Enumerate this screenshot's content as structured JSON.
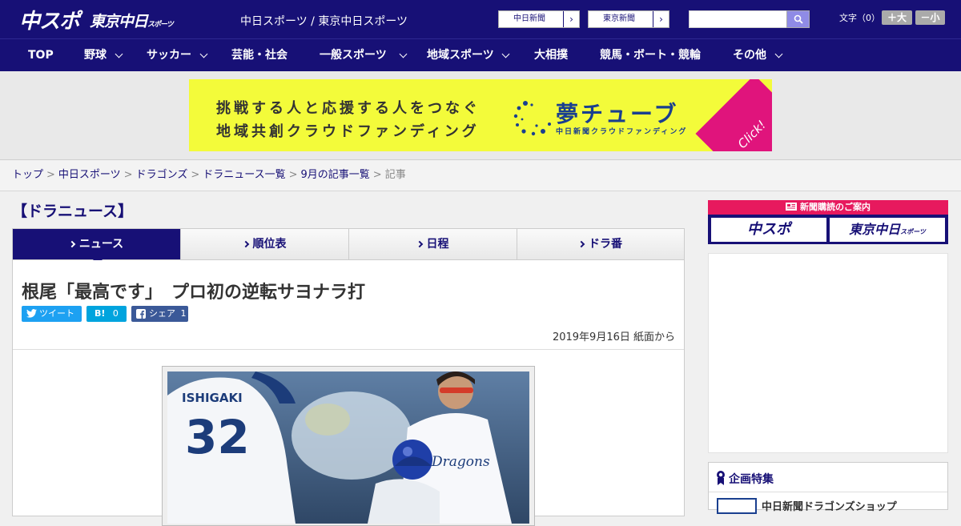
{
  "header": {
    "logo_main": "中スポ",
    "logo_tokyo": "東京中日",
    "logo_tokyo_small": "スポーツ",
    "site_names": "中日スポーツ / 東京中日スポーツ",
    "site_buttons": [
      "中日新聞",
      "東京新聞"
    ],
    "search_placeholder": "",
    "font_size_label": "文字（0）",
    "font_larger": "＋大",
    "font_smaller": "－小"
  },
  "nav": {
    "items": [
      {
        "label": "TOP",
        "dropdown": false
      },
      {
        "label": "野球",
        "dropdown": true
      },
      {
        "label": "サッカー",
        "dropdown": true
      },
      {
        "label": "芸能・社会",
        "dropdown": false
      },
      {
        "label": "一般スポーツ",
        "dropdown": true
      },
      {
        "label": "地域スポーツ",
        "dropdown": true
      },
      {
        "label": "大相撲",
        "dropdown": false
      },
      {
        "label": "競馬・ボート・競輪",
        "dropdown": false
      },
      {
        "label": "その他",
        "dropdown": true
      }
    ]
  },
  "banner": {
    "line1": "挑戦する人と応援する人をつなぐ",
    "line2": "地域共創クラウドファンディング",
    "logo": "夢チューブ",
    "sub": "中日新聞クラウドファンディング",
    "click": "Click!",
    "colors": {
      "bg": "#f3fb3a",
      "accent": "#e0147c",
      "logo": "#1a3f8f"
    }
  },
  "breadcrumb": {
    "items": [
      "トップ",
      "中日スポーツ",
      "ドラゴンズ",
      "ドラニュース一覧",
      "9月の記事一覧"
    ],
    "current": "記事",
    "separator": ">"
  },
  "section": {
    "title": "【ドラニュース】",
    "tabs": [
      {
        "label": "ニュース",
        "active": true
      },
      {
        "label": "順位表",
        "active": false
      },
      {
        "label": "日程",
        "active": false
      },
      {
        "label": "ドラ番",
        "active": false
      }
    ]
  },
  "article": {
    "headline": "根尾「最高です」　プロ初の逆転サヨナラ打",
    "share": {
      "tweet": "ツイート",
      "hatena_icon": "B!",
      "hatena_count": "0",
      "facebook": "シェア",
      "facebook_count": "1"
    },
    "dateline": "2019年9月16日 紙面から",
    "photo": {
      "jersey_name": "ISHIGAKI",
      "jersey_number": "32",
      "uniform_text": "Dragons"
    }
  },
  "sidebar": {
    "subscribe_title": "新聞購読のご案内",
    "subscribe_left": "中スポ",
    "subscribe_right": "東京中日",
    "subscribe_right_small": "スポーツ",
    "feature_title": "企画特集",
    "feature_item": "中日新聞ドラゴンズショップ"
  },
  "colors": {
    "brand": "#171076",
    "pink": "#e7195e",
    "twitter": "#1da1f2",
    "hatena": "#00a4de",
    "facebook": "#3b5998"
  }
}
